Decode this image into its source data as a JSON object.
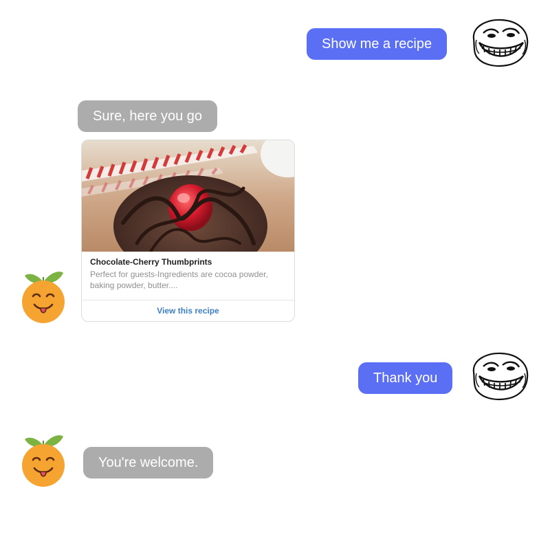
{
  "conversation": {
    "messages": [
      {
        "sender": "user",
        "text": "Show me a recipe"
      },
      {
        "sender": "bot",
        "text": "Sure, here you go"
      },
      {
        "sender": "user",
        "text": "Thank you"
      },
      {
        "sender": "bot",
        "text": "You're welcome."
      }
    ],
    "recipe_card": {
      "title": "Chocolate-Cherry Thumbprints",
      "description": "Perfect for guests-Ingredients are cocoa powder, baking powder, butter....",
      "action_label": "View this recipe",
      "image": "chocolate-cherry-cookie-photo",
      "link_color": "#3d7fc6"
    }
  },
  "avatars": {
    "user": "troll-face-icon",
    "bot": "tangerine-face-icon"
  },
  "colors": {
    "user_bubble": "#5a6ff4",
    "bot_bubble": "#acacac",
    "background": "#ffffff"
  }
}
